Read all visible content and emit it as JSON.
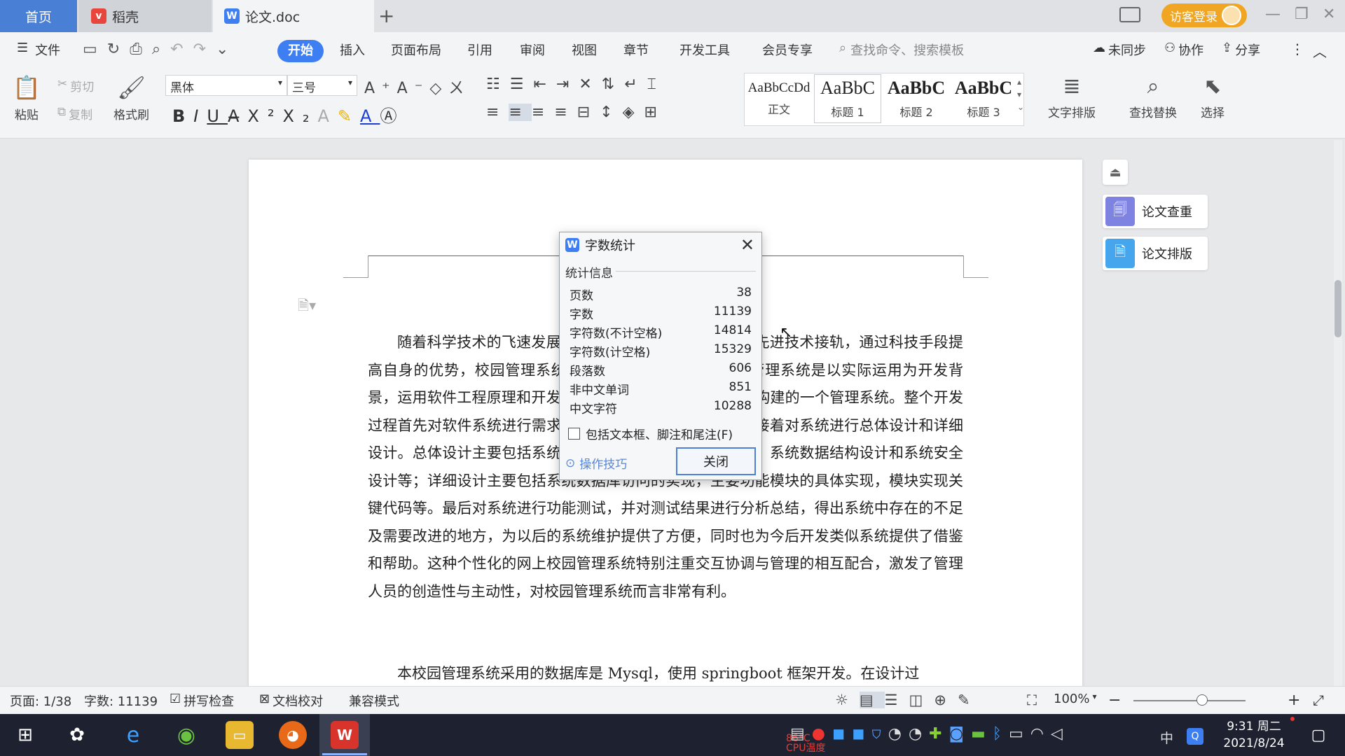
{
  "titlebar": {
    "tabs": [
      {
        "label": "首页",
        "active": false
      },
      {
        "label": "稻壳",
        "icon": "daoke-icon"
      },
      {
        "label": "论文.doc",
        "icon": "wps-writer-icon",
        "active": true
      }
    ],
    "new_tab": "+",
    "login_label": "访客登录"
  },
  "menubar": {
    "file_label": "文件",
    "items": [
      "开始",
      "插入",
      "页面布局",
      "引用",
      "审阅",
      "视图",
      "章节",
      "开发工具",
      "会员专享"
    ],
    "search_placeholder": "查找命令、搜索模板",
    "sync_label": "未同步",
    "collab_label": "协作",
    "share_label": "分享"
  },
  "ribbon": {
    "paste": "粘贴",
    "cut": "剪切",
    "copy": "复制",
    "format_painter": "格式刷",
    "font_name": "黑体",
    "font_size": "三号",
    "styles": [
      {
        "sample": "AaBbCcDd",
        "label": "正文"
      },
      {
        "sample": "AaBbC",
        "label": "标题 1"
      },
      {
        "sample": "AaBbC",
        "label": "标题 2"
      },
      {
        "sample": "AaBbC",
        "label": "标题 3"
      }
    ],
    "text_layout": "文字排版",
    "find_replace": "查找替换",
    "select": "选择"
  },
  "document": {
    "para1": "随着科学技术的飞速发展，各行各业都在努力与现代的先进技术接轨，通过科技手段提高自身的优势，校园管理系统当然也不能排除在外。校园管理系统是以实际运用为开发背景，运用软件工程原理和开发方法，采用 springboot 框架构建的一个管理系统。整个开发过程首先对软件系统进行需求分析，得出系统的主要功能。接着对系统进行总体设计和详细设计。总体设计主要包括系统功能设计、系统总体结构设计、系统数据结构设计和系统安全设计等；详细设计主要包括系统数据库访问的实现，主要功能模块的具体实现，模块实现关键代码等。最后对系统进行功能测试，并对测试结果进行分析总结，得出系统中存在的不足及需要改进的地方，为以后的系统维护提供了方便，同时也为今后开发类似系统提供了借鉴和帮助。这种个性化的网上校园管理系统特别注重交互协调与管理的相互配合，激发了管理人员的创造性与主动性，对校园管理系统而言非常有利。",
    "para2": "本校园管理系统采用的数据库是 Mysql，使用 springboot 框架开发。在设计过"
  },
  "dialog": {
    "title": "字数统计",
    "section": "统计信息",
    "stats": [
      {
        "label": "页数",
        "value": "38"
      },
      {
        "label": "字数",
        "value": "11139"
      },
      {
        "label": "字符数(不计空格)",
        "value": "14814"
      },
      {
        "label": "字符数(计空格)",
        "value": "15329"
      },
      {
        "label": "段落数",
        "value": "606"
      },
      {
        "label": "非中文单词",
        "value": "851"
      },
      {
        "label": "中文字符",
        "value": "10288"
      }
    ],
    "checkbox_label": "包括文本框、脚注和尾注(F)",
    "tips_label": "操作技巧",
    "close_label": "关闭"
  },
  "right_panel": {
    "check_label": "论文查重",
    "layout_label": "论文排版"
  },
  "statusbar": {
    "page": "页面: 1/38",
    "words": "字数: 11139",
    "spell": "拼写检查",
    "proof": "文档校对",
    "compat": "兼容模式",
    "zoom": "100%"
  },
  "taskbar": {
    "cpu_temp": "86°C",
    "cpu_label": "CPU温度",
    "ime": "中",
    "time": "9:31 周二",
    "date": "2021/8/24"
  },
  "colors": {
    "accent": "#3d7ef3",
    "login": "#f0a623",
    "taskbar": "#1d2130"
  }
}
